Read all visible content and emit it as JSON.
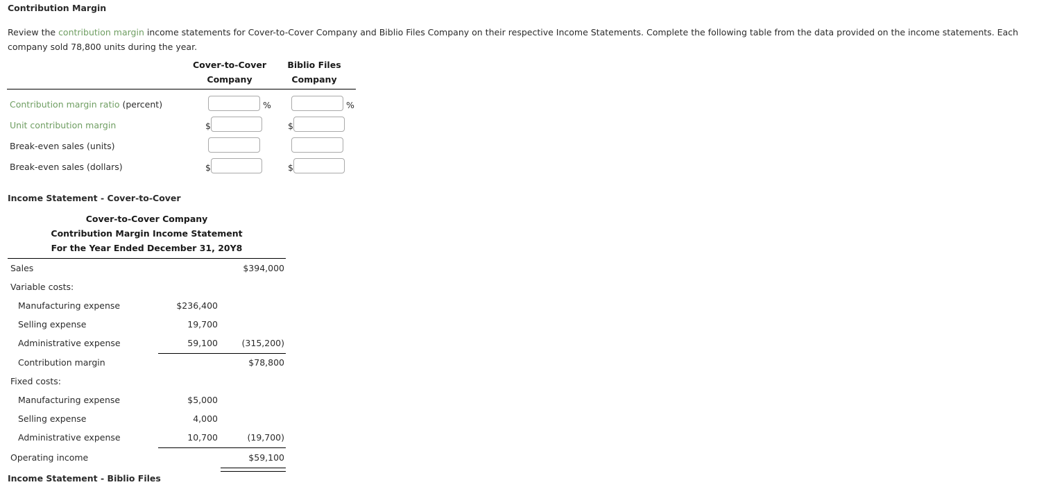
{
  "headings": {
    "contribution_margin": "Contribution Margin",
    "income_statement_ctc": "Income Statement - Cover-to-Cover",
    "income_statement_bf": "Income Statement - Biblio Files"
  },
  "intro": {
    "before_link": "Review the ",
    "link_text": "contribution margin",
    "after_link": " income statements for Cover-to-Cover Company and Biblio Files Company on their respective Income Statements. Complete the following table from the data provided on the income statements. Each company sold 78,800 units during the year."
  },
  "entry_table": {
    "col_headers": [
      {
        "line1": "Cover-to-Cover",
        "line2": "Company"
      },
      {
        "line1": "Biblio Files",
        "line2": "Company"
      }
    ],
    "rows": [
      {
        "label_green": "Contribution margin ratio",
        "label_plain": " (percent)",
        "prefix": "",
        "suffix": "%",
        "ctc_value": "",
        "bf_value": "",
        "placeholder": ""
      },
      {
        "label_green": "Unit contribution margin",
        "label_plain": "",
        "prefix": "$",
        "suffix": "",
        "ctc_value": "",
        "bf_value": "",
        "placeholder": ""
      },
      {
        "label_green": "",
        "label_plain": "Break-even sales (units)",
        "prefix": "",
        "suffix": "",
        "ctc_value": "",
        "bf_value": "",
        "placeholder": ""
      },
      {
        "label_green": "",
        "label_plain": "Break-even sales (dollars)",
        "prefix": "$",
        "suffix": "",
        "ctc_value": "",
        "bf_value": "",
        "placeholder": ""
      }
    ]
  },
  "statement_ctc": {
    "title_line1": "Cover-to-Cover Company",
    "title_line2": "Contribution Margin Income Statement",
    "title_line3": "For the Year Ended December 31, 20Y8",
    "rows": [
      {
        "label": "Sales",
        "indent": 0,
        "col1": "",
        "col2": "$394,000"
      },
      {
        "label": "Variable costs:",
        "indent": 0,
        "col1": "",
        "col2": ""
      },
      {
        "label": "Manufacturing expense",
        "indent": 1,
        "col1": "$236,400",
        "col2": ""
      },
      {
        "label": "Selling expense",
        "indent": 1,
        "col1": "19,700",
        "col2": ""
      },
      {
        "label": "Administrative expense",
        "indent": 1,
        "col1": "59,100",
        "col2": "(315,200)"
      },
      {
        "label": "Contribution margin",
        "indent": 1,
        "col1": "",
        "col2": "$78,800"
      },
      {
        "label": "Fixed costs:",
        "indent": 0,
        "col1": "",
        "col2": ""
      },
      {
        "label": "Manufacturing expense",
        "indent": 1,
        "col1": "$5,000",
        "col2": ""
      },
      {
        "label": "Selling expense",
        "indent": 1,
        "col1": "4,000",
        "col2": ""
      },
      {
        "label": "Administrative expense",
        "indent": 1,
        "col1": "10,700",
        "col2": "(19,700)"
      },
      {
        "label": "Operating income",
        "indent": 0,
        "col1": "",
        "col2": "$59,100"
      }
    ]
  },
  "colors": {
    "link_green": "#6f9e62",
    "text": "#2b2b2b",
    "rule": "#000000",
    "input_border": "#a9a9a9"
  }
}
